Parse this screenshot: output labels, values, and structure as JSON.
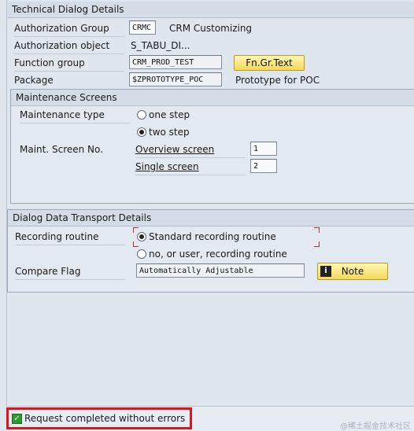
{
  "tech": {
    "title": "Technical Dialog Details",
    "auth_group_label": "Authorization Group",
    "auth_group_value": "CRMC",
    "auth_group_desc": "CRM Customizing",
    "auth_object_label": "Authorization object",
    "auth_object_value": "S_TABU_DI...",
    "func_group_label": "Function group",
    "func_group_value": "CRM_PROD_TEST",
    "func_group_button": "Fn.Gr.Text",
    "package_label": "Package",
    "package_value": "$ZPROTOTYPE_POC",
    "package_desc": "Prototype for POC"
  },
  "maint": {
    "title": "Maintenance Screens",
    "type_label": "Maintenance type",
    "one_step": "one step",
    "two_step": "two step",
    "selected": "two step",
    "screen_no_label": "Maint. Screen No.",
    "overview_label": "Overview screen",
    "overview_value": "1",
    "single_label": "Single screen",
    "single_value": "2"
  },
  "transport": {
    "title": "Dialog Data Transport Details",
    "rec_label": "Recording routine",
    "standard": "Standard recording routine",
    "no_user": "no, or user, recording routine",
    "selected": "Standard recording routine",
    "compare_label": "Compare Flag",
    "compare_value": "Automatically Adjustable",
    "note_button": "Note",
    "note_icon": "info-icon"
  },
  "status": {
    "message": "Request completed without errors",
    "icon": "checkmark-icon",
    "highlight_color": "#e0121c"
  },
  "watermark": "@稀土掘金技术社区"
}
